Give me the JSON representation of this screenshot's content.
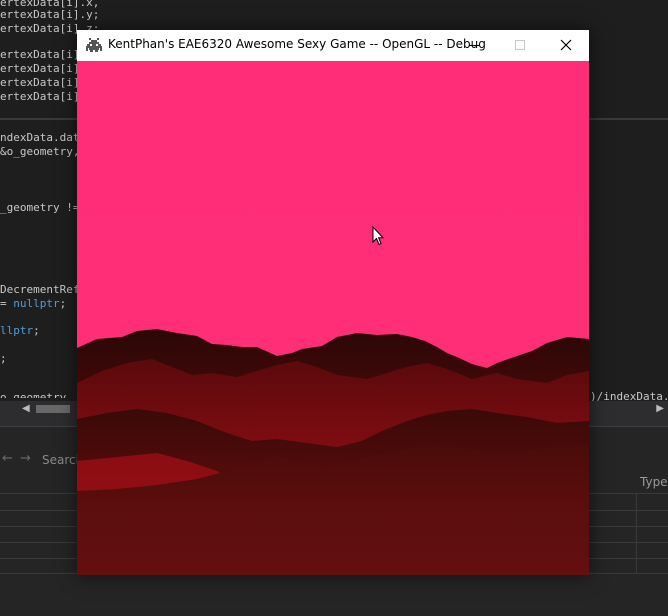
{
  "editor": {
    "lines": [
      {
        "text": "ertexData[i].x,"
      },
      {
        "text": "ertexData[i].y;"
      },
      {
        "text": "ertexData[i].z;"
      },
      {
        "text": "ertexData[i]."
      },
      {
        "text": "ertexData[i]."
      },
      {
        "text": "ertexData[i]."
      },
      {
        "text": "ertexData[i]."
      },
      {
        "text": "ndexData.data"
      },
      {
        "text": "&o_geometry,"
      },
      {
        "text": "_geometry !="
      },
      {
        "text": "DecrementRefe"
      },
      {
        "pre": "= ",
        "kw": "nullptr",
        "post": ";"
      },
      {
        "kw": "llptr",
        "post": ";"
      },
      {
        "text": ";"
      },
      {
        "text": "o_geometry"
      }
    ],
    "right_fragment": ")/indexData.s"
  },
  "panel": {
    "search_label": "Search",
    "type_header": "Type"
  },
  "game_window": {
    "title": "KentPhan's EAE6320 Awesome Sexy Game -- OpenGL -- Debug",
    "minimize_label": "—",
    "maximize_label": "☐",
    "close_label": "✕",
    "sky_color": "#ff2d78",
    "terrain_color": "#b0101a"
  },
  "icons": {
    "app": "space-invader-icon",
    "cursor": "mouse-pointer-icon"
  }
}
